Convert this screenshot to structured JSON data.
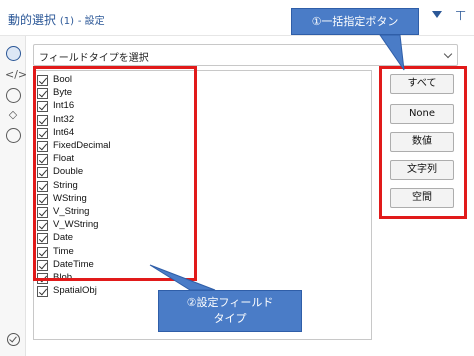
{
  "window": {
    "title": "動的選択",
    "title_suffix": "(1)",
    "title_section": "- 設定",
    "collapse_icon": "triangle-down-icon",
    "pin_icon": "pin-icon"
  },
  "dropdown": {
    "value": "フィールドタイプを選択"
  },
  "field_types": [
    {
      "label": "Bool",
      "checked": true
    },
    {
      "label": "Byte",
      "checked": true
    },
    {
      "label": "Int16",
      "checked": true
    },
    {
      "label": "Int32",
      "checked": true
    },
    {
      "label": "Int64",
      "checked": true
    },
    {
      "label": "FixedDecimal",
      "checked": true
    },
    {
      "label": "Float",
      "checked": true
    },
    {
      "label": "Double",
      "checked": true
    },
    {
      "label": "String",
      "checked": true
    },
    {
      "label": "WString",
      "checked": true
    },
    {
      "label": "V_String",
      "checked": true
    },
    {
      "label": "V_WString",
      "checked": true
    },
    {
      "label": "Date",
      "checked": true
    },
    {
      "label": "Time",
      "checked": true
    },
    {
      "label": "DateTime",
      "checked": true
    },
    {
      "label": "Blob",
      "checked": true
    },
    {
      "label": "SpatialObj",
      "checked": true
    }
  ],
  "buttons": {
    "all": "すべて",
    "none": "None",
    "numeric": "数値",
    "string": "文字列",
    "spatial": "空間"
  },
  "callouts": {
    "batch": "①一括指定ボタン",
    "settings_line1": "②設定フィールド",
    "settings_line2": "タイプ"
  },
  "colors": {
    "highlight": "#e11a1a",
    "callout": "#4a7cc7",
    "title": "#2b5797"
  }
}
